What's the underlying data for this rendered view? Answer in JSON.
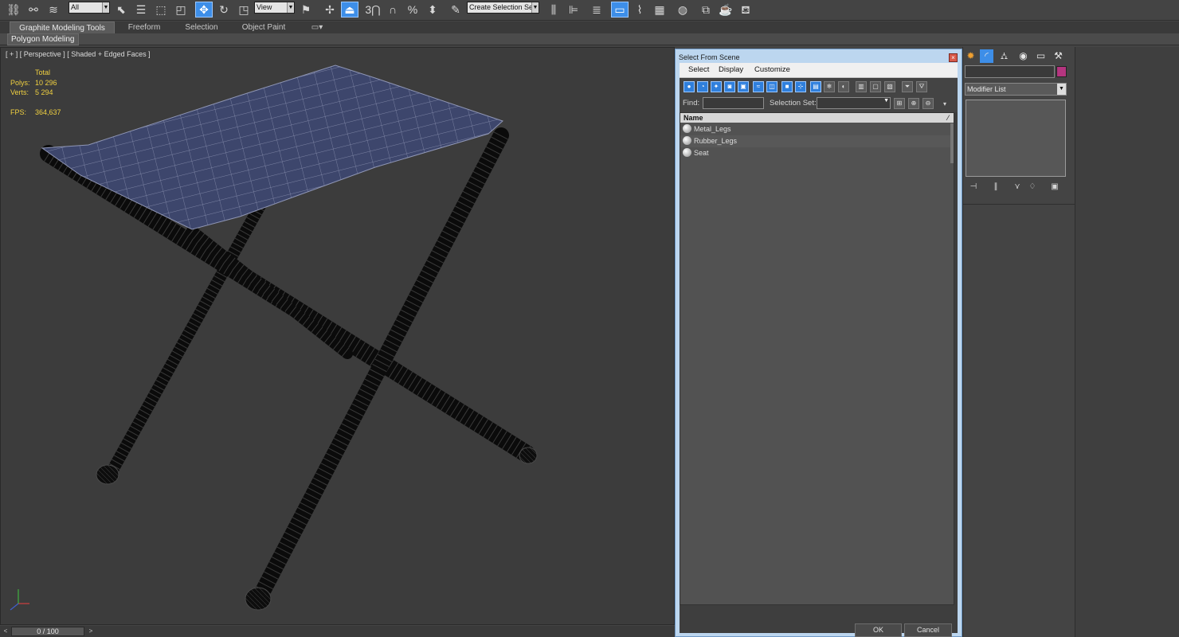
{
  "toolbar": {
    "filter_dropdown": "All",
    "ref_coord_dropdown": "View",
    "selection_set_dropdown": "Create Selection Se",
    "snap_3": "3",
    "snap_percent": "%"
  },
  "ribbon": {
    "tabs": [
      "Graphite Modeling Tools",
      "Freeform",
      "Selection",
      "Object Paint"
    ],
    "active_tab": "Graphite Modeling Tools",
    "panel_label": "Polygon Modeling"
  },
  "viewport": {
    "label": "[ + ] [ Perspective ] [ Shaded + Edged Faces ]",
    "stats": {
      "total_label": "Total",
      "polys_label": "Polys:",
      "polys_value": "10 296",
      "verts_label": "Verts:",
      "verts_value": "5 294",
      "fps_label": "FPS:",
      "fps_value": "364,637"
    },
    "seat_color": "#3d466c",
    "wire_color": "#8f96b5"
  },
  "timeline": {
    "frame": "0 / 100",
    "prev": "<",
    "next": ">"
  },
  "dialog": {
    "title": "Select From Scene",
    "close": "×",
    "menu": [
      "Select",
      "Display",
      "Customize"
    ],
    "find_label": "Find:",
    "selection_set_label": "Selection Set:",
    "column_name": "Name",
    "objects": [
      "Metal_Legs",
      "Rubber_Legs",
      "Seat"
    ],
    "ok": "OK",
    "cancel": "Cancel"
  },
  "command_panel": {
    "modifier_list": "Modifier List",
    "object_color": "#b4357f"
  }
}
